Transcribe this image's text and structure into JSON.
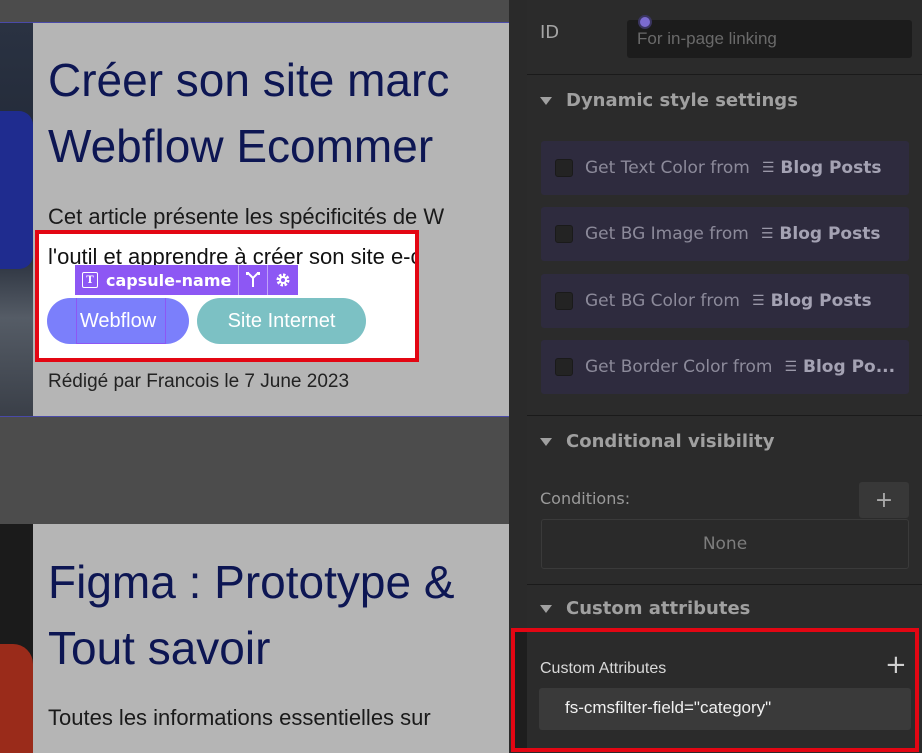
{
  "canvas": {
    "card1": {
      "title_line1": "Créer son site marc",
      "title_line2": "Webflow Ecommer",
      "desc_line1": "Cet article présente les spécificités de W",
      "desc_line2": "l'outil et apprendre à créer son site e-co",
      "tags": [
        "Webflow",
        "Site Internet"
      ],
      "meta": "Rédigé par Francois le 7 June 2023"
    },
    "selection_badge": {
      "element_name": "capsule-name"
    },
    "card2": {
      "title_line1": "Figma : Prototype &",
      "title_line2": "Tout savoir",
      "desc_line1": "Toutes les informations essentielles sur"
    }
  },
  "panel": {
    "id_field": {
      "label": "ID",
      "placeholder": "For in-page linking"
    },
    "dynamic_style": {
      "heading": "Dynamic style settings",
      "items": [
        {
          "label": "Get Text Color from",
          "source": "Blog Posts"
        },
        {
          "label": "Get BG Image from",
          "source": "Blog Posts"
        },
        {
          "label": "Get BG Color from",
          "source": "Blog Posts"
        },
        {
          "label": "Get Border Color from",
          "source": "Blog Po..."
        }
      ]
    },
    "conditional_visibility": {
      "heading": "Conditional visibility",
      "conditions_label": "Conditions:",
      "add_symbol": "+",
      "none_text": "None"
    },
    "custom_attributes": {
      "heading": "Custom attributes",
      "title": "Custom Attributes",
      "add_symbol": "+",
      "entries": [
        "fs-cmsfilter-field=\"category\""
      ]
    }
  },
  "colors": {
    "highlight_border": "#e30613",
    "selection_purple": "#8d57f4",
    "tag_webflow": "#7b7ffb",
    "tag_site": "#7cc1c4",
    "title_navy": "#0d1653"
  }
}
